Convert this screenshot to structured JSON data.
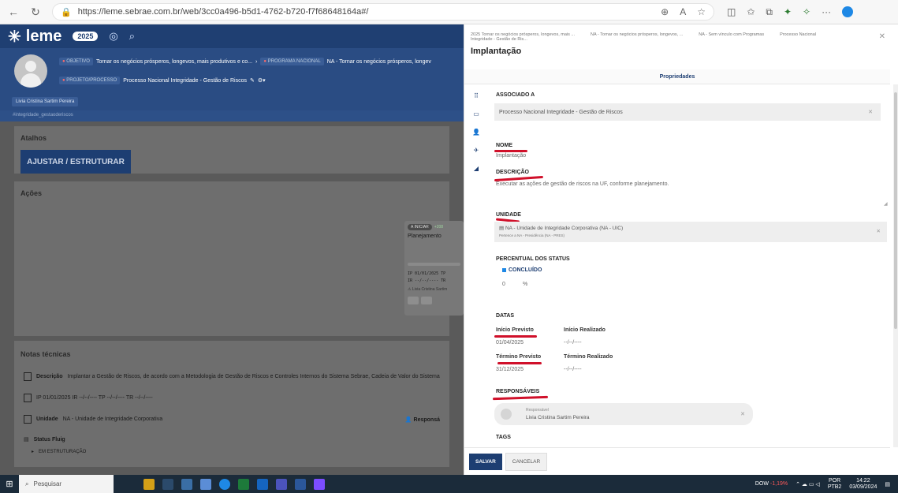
{
  "browser": {
    "url": "https://leme.sebrae.com.br/web/3cc0a496-b5d1-4762-b720-f7f68648164a#/"
  },
  "app": {
    "logo": "leme",
    "year": "2025",
    "crumbs": {
      "objetivo_tag": "OBJETIVO",
      "objetivo_text": "Tornar os negócios prósperos, longevos, mais produtivos e co...",
      "programa_tag": "PROGRAMA NACIONAL",
      "programa_text": "NA - Tornar os negócios prósperos, longev",
      "projeto_tag": "PROJETO/PROCESSO",
      "projeto_text": "Processo Nacional Integridade - Gestão de Riscos"
    },
    "user_chip": "Livia Cristina Sartim Pereira",
    "hashtag": "#integridade_gestaoderiscos",
    "atalhos_title": "Atalhos",
    "ajustar_button": "AJUSTAR / ESTRUTURAR",
    "acoes_title": "Ações",
    "kanban": {
      "badge": "A INICIAR",
      "plus": "+208",
      "title": "Planejamento",
      "line1": "IP 01/01/2025  TP",
      "line2": "IR --/--/----  TR",
      "resp": "Livia Cristina Sartim"
    },
    "notas_title": "Notas técnicas",
    "notas": {
      "descricao_label": "Descrição",
      "descricao_text": "Implantar a Gestão de Riscos, de acordo com a Metodologia de Gestão de Riscos e Controles Internos do Sistema Sebrae, Cadeia de Valor do Sistema",
      "dates_text": "IP 01/01/2025   IR --/--/----   TP --/--/----   TR --/--/----",
      "unidade_label": "Unidade",
      "unidade_text": "NA - Unidade de Integridade Corporativa",
      "responsavel_label": "Responsá",
      "status_label": "Status Fluig",
      "status_value": "EM ESTRUTURAÇÃO"
    }
  },
  "panel": {
    "crumbs": [
      "2025    Tornar os negócios prósperos, longevos, mais ...",
      "NA - Tornar os negócios prósperos, longevos, ...",
      "NA - Sem vínculo com Programas",
      "Processo Nacional"
    ],
    "crumb_sub": "Integridade - Gestão de Ris...",
    "title": "Implantação",
    "tab": "Propriedades",
    "associado_label": "ASSOCIADO A",
    "associado_value": "Processo Nacional Integridade - Gestão de Riscos",
    "nome_label": "NOME",
    "nome_value": "Implantação",
    "descricao_label": "DESCRIÇÃO",
    "descricao_value": "Executar as ações de gestão de riscos na UF, conforme planejamento.",
    "unidade_label": "UNIDADE",
    "unidade_value": "NA - Unidade de Integridade Corporativa (NA - UIC)",
    "unidade_sub": "Pertence a NA - Presidência (NA - PRES)",
    "percentual_label": "PERCENTUAL DOS STATUS",
    "concluido_label": "CONCLUÍDO",
    "percent_value": "0",
    "percent_unit": "%",
    "datas_label": "DATAS",
    "inicio_previsto_label": "Início Previsto",
    "inicio_previsto_value": "01/04/2025",
    "inicio_realizado_label": "Início Realizado",
    "inicio_realizado_value": "--/--/----",
    "termino_previsto_label": "Término Previsto",
    "termino_previsto_value": "31/12/2025",
    "termino_realizado_label": "Término Realizado",
    "termino_realizado_value": "--/--/----",
    "responsaveis_label": "RESPONSÁVEIS",
    "responsavel_role": "Responsável",
    "responsavel_name": "Livia Cristina Sartim Pereira",
    "tags_label": "TAGS",
    "salvar_button": "SALVAR",
    "cancelar_button": "CANCELAR"
  },
  "taskbar": {
    "search_placeholder": "Pesquisar",
    "dow_label": "DOW",
    "dow_change": "-1,19%",
    "lang": "POR",
    "lang_sub": "PTB2",
    "time": "14:22",
    "date": "03/09/2024"
  },
  "colors": {
    "primary": "#1d3e72",
    "highlight": "#d0102a"
  }
}
